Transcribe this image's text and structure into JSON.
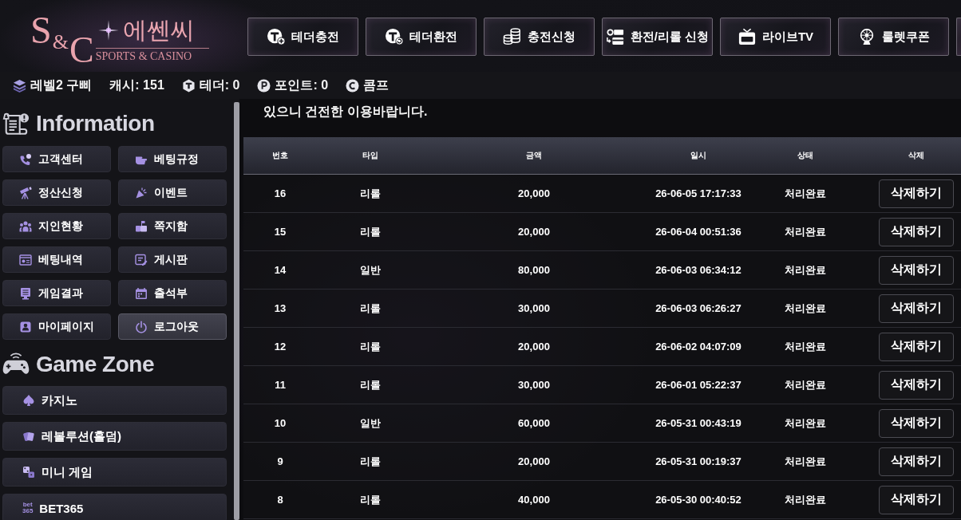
{
  "logo": {
    "monogram": "S&C",
    "name": "에쎈씨",
    "tagline": "SPORTS & CASINO"
  },
  "nav": [
    {
      "label": "테더충전"
    },
    {
      "label": "테더환전"
    },
    {
      "label": "충전신청"
    },
    {
      "label": "환전/리롤 신청"
    },
    {
      "label": "라이브TV"
    },
    {
      "label": "룰렛쿠폰"
    }
  ],
  "status_bar": [
    {
      "kind": "level",
      "label": "레벨2 구삐"
    },
    {
      "kind": "cash",
      "label": "캐시: 151"
    },
    {
      "kind": "tether",
      "label": "테더: 0"
    },
    {
      "kind": "point",
      "label": "포인트: 0"
    },
    {
      "kind": "comp",
      "label": "콤프"
    }
  ],
  "sidebar": {
    "information": {
      "title": "Information",
      "items": [
        {
          "label": "고객센터",
          "selected": false
        },
        {
          "label": "베팅규정",
          "selected": false
        },
        {
          "label": "정산신청",
          "selected": false
        },
        {
          "label": "이벤트",
          "selected": false
        },
        {
          "label": "지인현황",
          "selected": false
        },
        {
          "label": "쪽지함",
          "selected": false
        },
        {
          "label": "베팅내역",
          "selected": false
        },
        {
          "label": "게시판",
          "selected": false
        },
        {
          "label": "게임결과",
          "selected": false
        },
        {
          "label": "출석부",
          "selected": false
        },
        {
          "label": "마이페이지",
          "selected": false
        },
        {
          "label": "로그아웃",
          "selected": true
        }
      ]
    },
    "game_zone": {
      "title": "Game Zone",
      "items": [
        {
          "label": "카지노"
        },
        {
          "label": "레볼루션(홀덤)"
        },
        {
          "label": "미니 게임"
        },
        {
          "label": "BET365",
          "logo_text": [
            "bet",
            "365"
          ]
        }
      ]
    }
  },
  "notice": "있으니 건전한 이용바랍니다.",
  "table": {
    "columns": [
      "번호",
      "타입",
      "금액",
      "일시",
      "상태",
      "삭제"
    ],
    "rows": [
      {
        "no": "16",
        "type": "리롤",
        "amount": "20,000",
        "time": "26-06-05 17:17:33",
        "status": "처리완료",
        "action": "삭제하기"
      },
      {
        "no": "15",
        "type": "리롤",
        "amount": "20,000",
        "time": "26-06-04 00:51:36",
        "status": "처리완료",
        "action": "삭제하기"
      },
      {
        "no": "14",
        "type": "일반",
        "amount": "80,000",
        "time": "26-06-03 06:34:12",
        "status": "처리완료",
        "action": "삭제하기"
      },
      {
        "no": "13",
        "type": "리롤",
        "amount": "30,000",
        "time": "26-06-03 06:26:27",
        "status": "처리완료",
        "action": "삭제하기"
      },
      {
        "no": "12",
        "type": "리롤",
        "amount": "20,000",
        "time": "26-06-02 04:07:09",
        "status": "처리완료",
        "action": "삭제하기"
      },
      {
        "no": "11",
        "type": "리롤",
        "amount": "30,000",
        "time": "26-06-01 05:22:37",
        "status": "처리완료",
        "action": "삭제하기"
      },
      {
        "no": "10",
        "type": "일반",
        "amount": "60,000",
        "time": "26-05-31 00:43:19",
        "status": "처리완료",
        "action": "삭제하기"
      },
      {
        "no": "9",
        "type": "리롤",
        "amount": "20,000",
        "time": "26-05-31 00:19:37",
        "status": "처리완료",
        "action": "삭제하기"
      },
      {
        "no": "8",
        "type": "리롤",
        "amount": "40,000",
        "time": "26-05-30 00:40:52",
        "status": "처리완료",
        "action": "삭제하기"
      }
    ]
  }
}
